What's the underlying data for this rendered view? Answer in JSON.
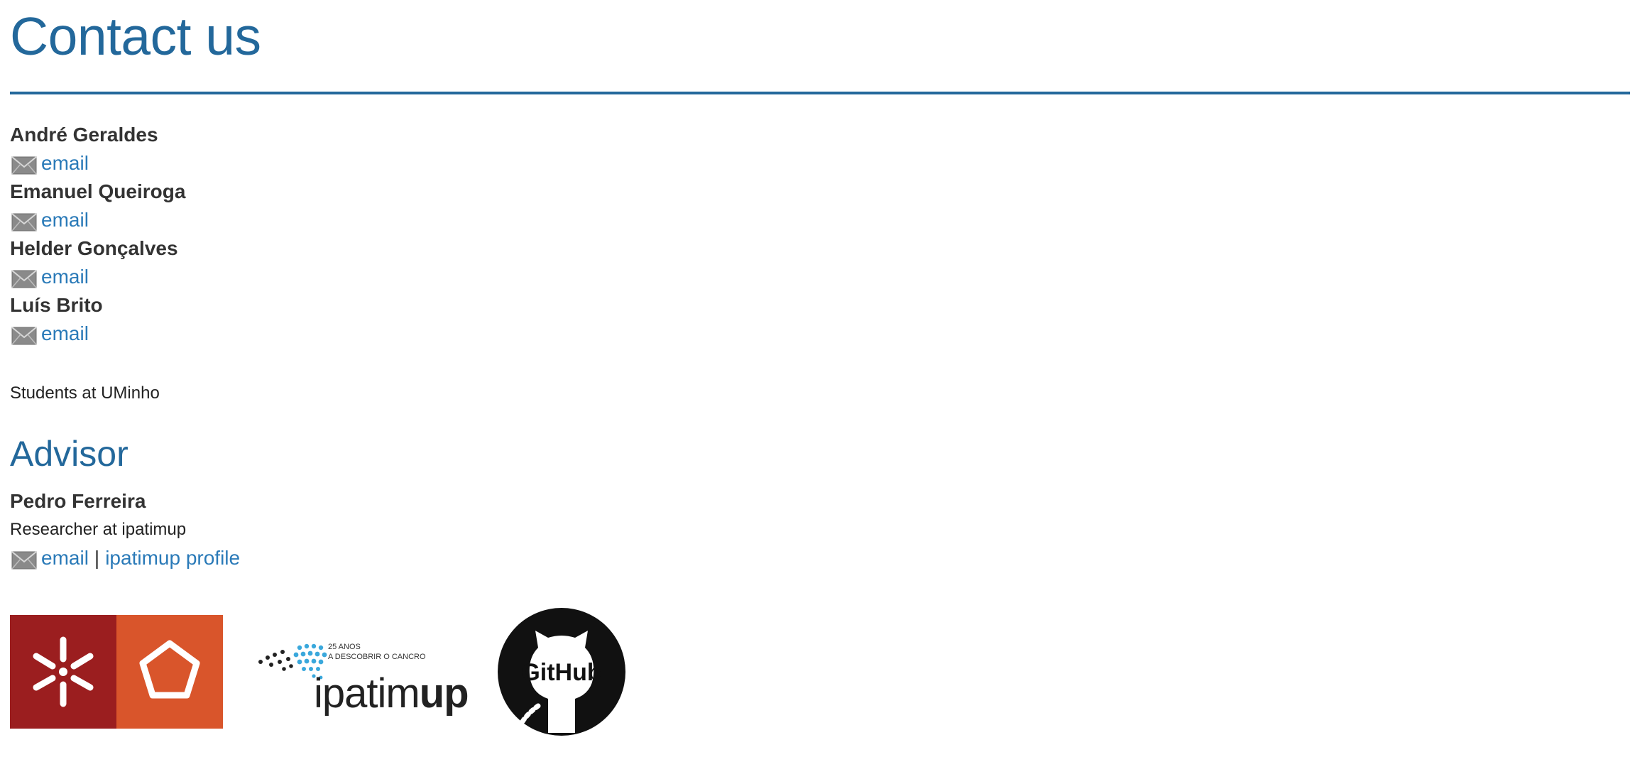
{
  "page": {
    "title": "Contact us"
  },
  "contacts": [
    {
      "name": "André Geraldes",
      "email_label": "email"
    },
    {
      "name": "Emanuel Queiroga",
      "email_label": "email"
    },
    {
      "name": "Helder Gonçalves",
      "email_label": "email"
    },
    {
      "name": "Luís Brito",
      "email_label": "email"
    }
  ],
  "students_note": "Students at UMinho",
  "advisor": {
    "heading": "Advisor",
    "name": "Pedro Ferreira",
    "role": "Researcher at ipatimup",
    "email_label": "email",
    "separator": "|",
    "profile_label": "ipatimup profile"
  },
  "logos": {
    "uminho": {
      "icon": "uminho-logo",
      "colors": [
        "#9b1e1f",
        "#d9552b"
      ]
    },
    "ipatimup": {
      "icon": "ipatimup-logo",
      "tagline_1": "25 ANOS",
      "tagline_2": "A DESCOBRIR O CANCRO",
      "word_regular": "ipatim",
      "word_bold": "up"
    },
    "github": {
      "icon": "github-logo",
      "label": "GitHub"
    }
  },
  "colors": {
    "heading": "#23689b",
    "link": "#2a7ab8",
    "text": "#333333"
  }
}
